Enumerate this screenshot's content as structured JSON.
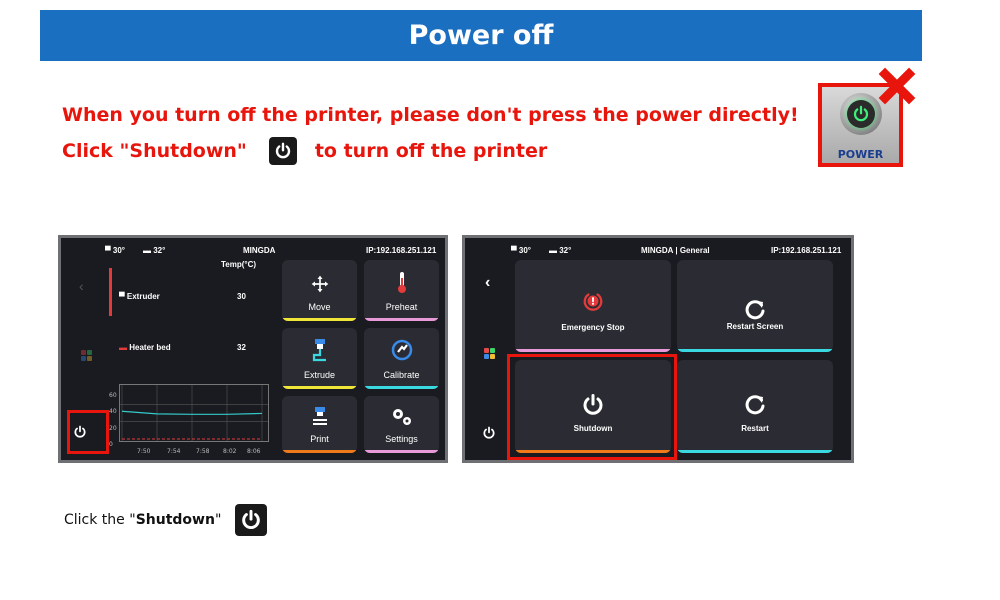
{
  "banner_title": "Power off",
  "warning": {
    "line1": "When you turn off the printer, please don't press the power directly!",
    "line2_before": "Click \"Shutdown\"",
    "line2_after": "to turn off the printer"
  },
  "power_button_label": "POWER",
  "screen_a": {
    "extruder_temp_icon": "30°",
    "bed_temp_icon": "32°",
    "title": "MINGDA",
    "ip": "IP:192.168.251.121",
    "temp_header": "Temp(°C)",
    "rows": [
      {
        "label": "Extruder",
        "value": "30"
      },
      {
        "label": "Heater bed",
        "value": "32"
      }
    ],
    "chart_data": {
      "type": "line",
      "x": [
        "7:50",
        "7:54",
        "7:58",
        "8:02",
        "8:06"
      ],
      "y_ticks": [
        "60",
        "40",
        "20",
        "0"
      ],
      "ylim": [
        0,
        60
      ],
      "series": [
        {
          "color": "#35c9c9",
          "values": [
            32,
            29,
            28.5,
            28.5,
            29.5
          ]
        },
        {
          "color": "#e33b3b",
          "values": [
            0,
            0,
            0,
            0,
            0
          ]
        }
      ]
    },
    "tiles": [
      {
        "label": "Move",
        "color": "#f0e63a"
      },
      {
        "label": "Preheat",
        "color": "#e89ad8"
      },
      {
        "label": "Extrude",
        "color": "#f0e63a"
      },
      {
        "label": "Calibrate",
        "color": "#3ad8e0"
      },
      {
        "label": "Print",
        "color": "#f07a1a"
      },
      {
        "label": "Settings",
        "color": "#e89ad8"
      }
    ]
  },
  "screen_b": {
    "extruder_temp_icon": "30°",
    "bed_temp_icon": "32°",
    "title": "MINGDA | General",
    "ip": "IP:192.168.251.121",
    "tiles": [
      {
        "label": "Emergency Stop",
        "color": "#e89ad8"
      },
      {
        "label": "Restart Screen",
        "color": "#3ad8e0"
      },
      {
        "label": "Shutdown",
        "color": "#f07a1a"
      },
      {
        "label": "Restart",
        "color": "#3ad8e0"
      }
    ]
  },
  "caption": {
    "before": "Click the \"",
    "bold": "Shutdown",
    "after": "\""
  },
  "colors": {
    "banner": "#1b6fc1",
    "warning": "#e8150c",
    "screen_bg": "#1a1b20",
    "tile_bg": "#2b2c33"
  }
}
